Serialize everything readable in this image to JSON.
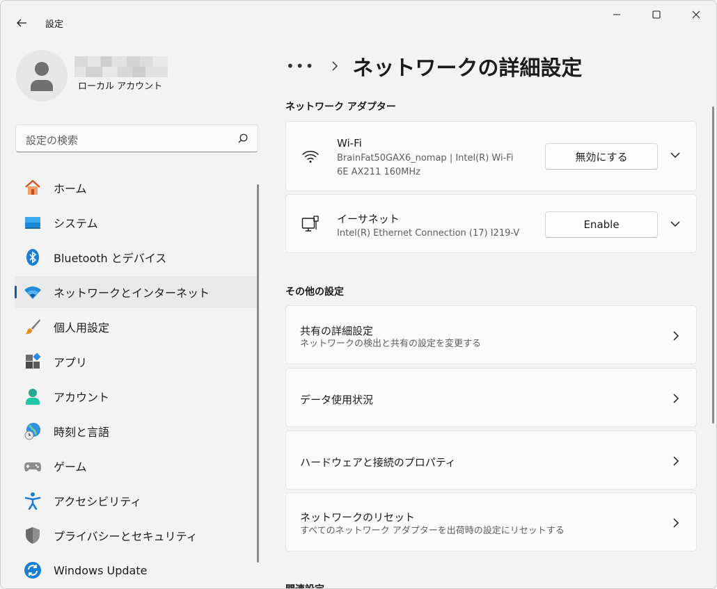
{
  "app": {
    "title": "設定"
  },
  "user": {
    "account_type": "ローカル アカウント"
  },
  "search": {
    "placeholder": "設定の検索"
  },
  "nav": {
    "items": [
      {
        "label": "ホーム",
        "icon": "home-icon"
      },
      {
        "label": "システム",
        "icon": "system-icon"
      },
      {
        "label": "Bluetooth とデバイス",
        "icon": "bluetooth-icon"
      },
      {
        "label": "ネットワークとインターネット",
        "icon": "wifi-icon",
        "active": true
      },
      {
        "label": "個人用設定",
        "icon": "brush-icon"
      },
      {
        "label": "アプリ",
        "icon": "apps-icon"
      },
      {
        "label": "アカウント",
        "icon": "account-icon"
      },
      {
        "label": "時刻と言語",
        "icon": "globe-clock-icon"
      },
      {
        "label": "ゲーム",
        "icon": "gamepad-icon"
      },
      {
        "label": "アクセシビリティ",
        "icon": "accessibility-icon"
      },
      {
        "label": "プライバシーとセキュリティ",
        "icon": "shield-icon"
      },
      {
        "label": "Windows Update",
        "icon": "update-icon"
      }
    ]
  },
  "breadcrumb": {
    "more": "•••",
    "title": "ネットワークの詳細設定"
  },
  "adapters": {
    "heading": "ネットワーク アダプター",
    "items": [
      {
        "name": "Wi-Fi",
        "desc_line1": "BrainFat50GAX6_nomap | Intel(R) Wi-Fi",
        "desc_line2": "6E AX211 160MHz",
        "button": "無効にする"
      },
      {
        "name": "イーサネット",
        "desc_line1": "Intel(R) Ethernet Connection (17) I219-V",
        "button": "Enable"
      }
    ]
  },
  "more_settings": {
    "heading": "その他の設定",
    "items": [
      {
        "title": "共有の詳細設定",
        "subtitle": "ネットワークの検出と共有の設定を変更する"
      },
      {
        "title": "データ使用状況"
      },
      {
        "title": "ハードウェアと接続のプロパティ"
      },
      {
        "title": "ネットワークのリセット",
        "subtitle": "すべてのネットワーク アダプターを出荷時の設定にリセットする"
      }
    ]
  },
  "related": {
    "heading": "関連設定"
  },
  "colors": {
    "accent": "#005fb8",
    "background": "#f3f3f3",
    "card": "#fbfbfb"
  }
}
